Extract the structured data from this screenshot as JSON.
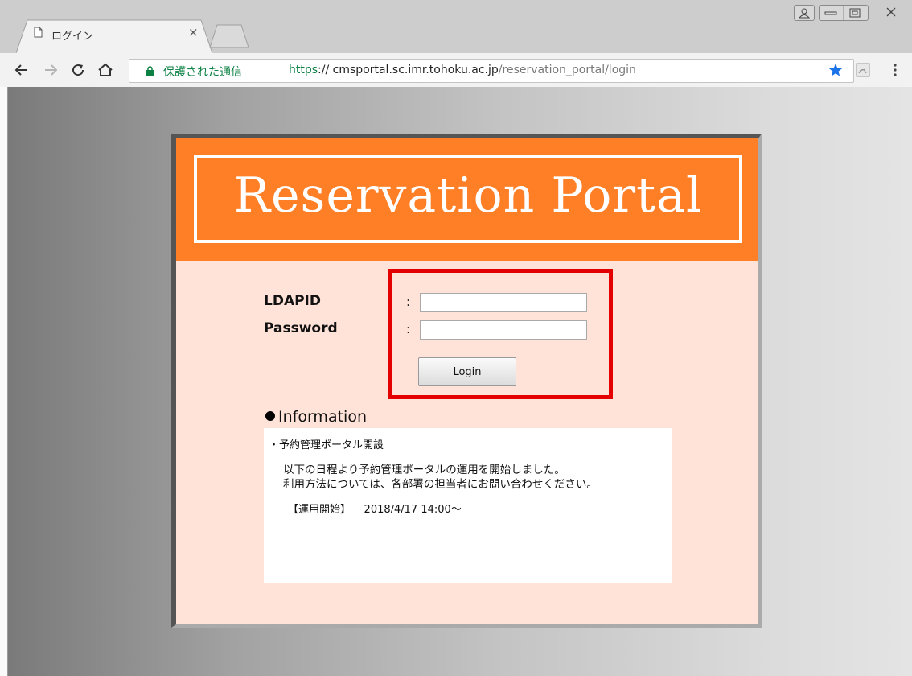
{
  "browser": {
    "tab": {
      "title": "ログイン",
      "close_glyph": "×"
    },
    "toolbar": {
      "back_icon": "←",
      "forward_icon": "→",
      "reload_icon": "C",
      "home_icon": "⌂",
      "secure_label": "保護された通信",
      "url": {
        "scheme": "https",
        "separator": "://",
        "host": " cmsportal.sc.imr.tohoku.ac.jp",
        "path": "/reservation_portal/login"
      }
    },
    "colors": {
      "secure": "#0b8043",
      "star": "#1a73e8"
    }
  },
  "page": {
    "banner_title": "Reservation Portal",
    "form": {
      "ldapid_label": "LDAPID",
      "password_label": "Password",
      "colon": ":",
      "ldapid_value": "",
      "password_value": "",
      "login_button": "Login"
    },
    "information": {
      "heading": "Information",
      "item_title": "・予約管理ポータル開設",
      "lines": [
        "以下の日程より予約管理ポータルの運用を開始しました。",
        "利用方法については、各部署の担当者にお問い合わせください。"
      ],
      "start_label": "【運用開始】",
      "start_value": "2018/4/17 14:00～"
    },
    "colors": {
      "banner": "#ff7f27",
      "panel_bg": "#ffe3d8",
      "highlight": "#e50000"
    }
  }
}
